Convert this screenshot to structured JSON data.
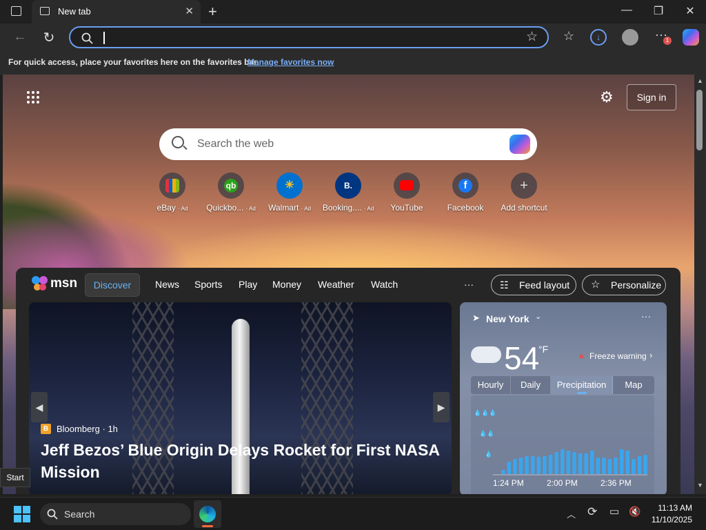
{
  "browser": {
    "tab_title": "New tab",
    "favorites_bar": {
      "message": "For quick access, place your favorites here on the favorites bar.",
      "link": "Manage favorites now"
    },
    "address_value": ""
  },
  "ntp": {
    "sign_in": "Sign in",
    "search_placeholder": "Search the web",
    "shortcuts": [
      {
        "label": "eBay",
        "ad": "· Ad",
        "icon": "ebay-bag-icon"
      },
      {
        "label": "Quickbo...",
        "ad": "· Ad",
        "icon": "quickbooks-icon"
      },
      {
        "label": "Walmart",
        "ad": "· Ad",
        "icon": "walmart-spark-icon"
      },
      {
        "label": "Booking....",
        "ad": "· Ad",
        "icon": "booking-icon"
      },
      {
        "label": "YouTube",
        "ad": "",
        "icon": "youtube-icon"
      },
      {
        "label": "Facebook",
        "ad": "",
        "icon": "facebook-icon"
      },
      {
        "label": "Add shortcut",
        "ad": "",
        "icon": "plus-icon"
      }
    ]
  },
  "msn": {
    "logo": "msn",
    "tabs": [
      "Discover",
      "News",
      "Sports",
      "Play",
      "Money",
      "Weather",
      "Watch"
    ],
    "more": "···",
    "feed_layout": "Feed layout",
    "personalize": "Personalize",
    "hero": {
      "source": "Bloomberg",
      "source_initial": "B",
      "age": "· 1h",
      "headline": "Jeff Bezos’ Blue Origin Delays Rocket for First NASA Mission"
    },
    "weather": {
      "city": "New York",
      "temp": "54",
      "unit": "°F",
      "warning": "Freeze warning",
      "tabs": [
        "Hourly",
        "Daily",
        "Precipitation",
        "Map"
      ],
      "active_tab": "Precipitation",
      "x_labels": [
        "1:24 PM",
        "2:00 PM",
        "2:36 PM"
      ]
    }
  },
  "taskbar": {
    "start_tooltip": "Start",
    "search": "Search",
    "time": "11:13 AM",
    "date": "11/10/2025"
  },
  "colors": {
    "accent": "#6b9ef2",
    "discover": "#6ab2f2",
    "precip_bar": "#3aa6ee"
  }
}
